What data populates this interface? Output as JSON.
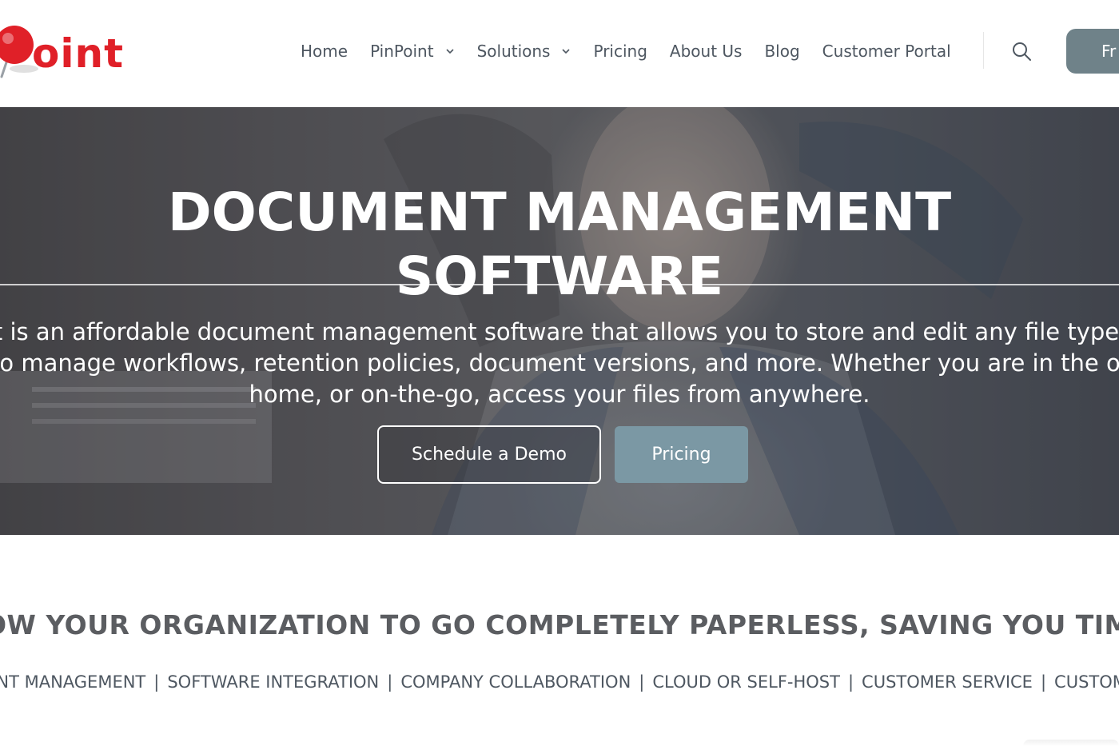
{
  "header": {
    "logo_text": "oint",
    "nav": [
      {
        "label": "Home",
        "has_dropdown": false
      },
      {
        "label": "PinPoint",
        "has_dropdown": true
      },
      {
        "label": "Solutions",
        "has_dropdown": true
      },
      {
        "label": "Pricing",
        "has_dropdown": false
      },
      {
        "label": "About Us",
        "has_dropdown": false
      },
      {
        "label": "Blog",
        "has_dropdown": false
      },
      {
        "label": "Customer Portal",
        "has_dropdown": false
      }
    ],
    "cta_label": "Fr"
  },
  "hero": {
    "title": "DOCUMENT MANAGEMENT SOFTWARE",
    "description_lines": [
      "nt is an affordable document management software that allows you to store and edit any file type v",
      "to manage workflows, retention policies, document versions, and more. Whether you are in the of",
      "home, or on-the-go, access your files from anywhere."
    ],
    "demo_button": "Schedule a Demo",
    "pricing_button": "Pricing"
  },
  "tagline": "OW YOUR ORGANIZATION TO GO COMPLETELY PAPERLESS, SAVING YOU TIME AND MO",
  "features": [
    "MENT MANAGEMENT",
    "SOFTWARE INTEGRATION",
    "COMPANY COLLABORATION",
    "CLOUD OR SELF-HOST",
    "CUSTOMER SERVICE",
    "CUSTOMER TR"
  ],
  "colors": {
    "brand_red": "#e02028",
    "nav_text": "#4e5761",
    "cta_bg": "#6f8289",
    "pricing_bg": "#7b98a4"
  }
}
